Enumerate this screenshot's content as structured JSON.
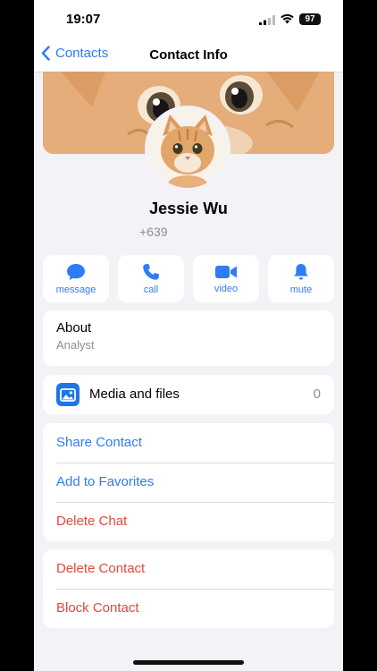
{
  "status": {
    "time": "19:07",
    "battery": "97"
  },
  "nav": {
    "back_label": "Contacts",
    "title": "Contact Info"
  },
  "profile": {
    "name": "Jessie Wu",
    "phone": "+639"
  },
  "actions": [
    {
      "label": "message",
      "icon": "message-icon"
    },
    {
      "label": "call",
      "icon": "phone-icon"
    },
    {
      "label": "video",
      "icon": "video-icon"
    },
    {
      "label": "mute",
      "icon": "bell-icon"
    }
  ],
  "about": {
    "title": "About",
    "value": "Analyst"
  },
  "media": {
    "label": "Media and files",
    "count": "0"
  },
  "options_primary": [
    {
      "label": "Share Contact"
    },
    {
      "label": "Add to Favorites"
    },
    {
      "label": "Delete Chat"
    }
  ],
  "options_danger": [
    {
      "label": "Delete Contact"
    },
    {
      "label": "Block Contact"
    }
  ],
  "colors": {
    "accent": "#2f7cf6",
    "destructive": "#e5483d",
    "background": "#f2f2f7"
  }
}
